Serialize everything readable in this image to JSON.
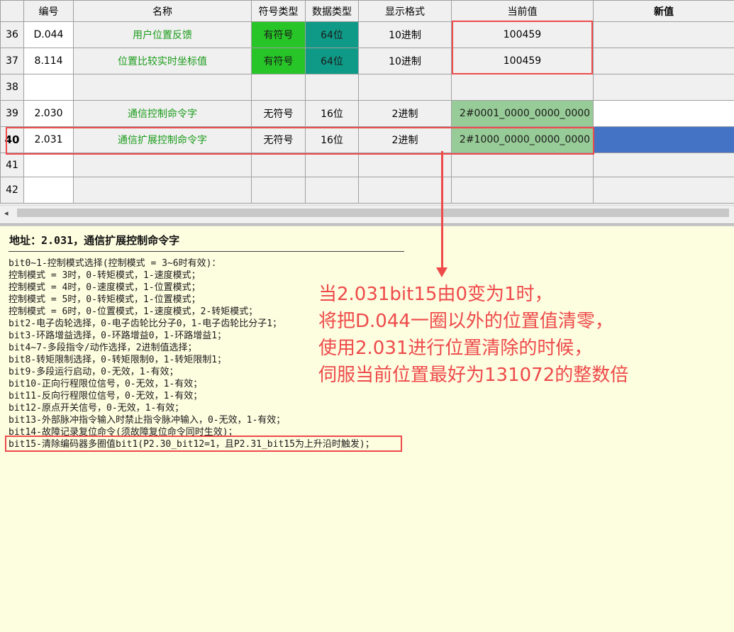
{
  "grid": {
    "headers": {
      "rownum": "",
      "code": "编号",
      "name": "名称",
      "sign_type": "符号类型",
      "data_type": "数据类型",
      "display_format": "显示格式",
      "current_value": "当前值",
      "new_value": "新值"
    },
    "rows": [
      {
        "num": "36",
        "code": "D.044",
        "name": "用户位置反馈",
        "sign_type": "有符号",
        "data_type": "64位",
        "format": "10进制",
        "current": "100459",
        "new": ""
      },
      {
        "num": "37",
        "code": "8.114",
        "name": "位置比较实时坐标值",
        "sign_type": "有符号",
        "data_type": "64位",
        "format": "10进制",
        "current": "100459",
        "new": ""
      },
      {
        "num": "38",
        "code": "",
        "name": "",
        "sign_type": "",
        "data_type": "",
        "format": "",
        "current": "",
        "new": ""
      },
      {
        "num": "39",
        "code": "2.030",
        "name": "通信控制命令字",
        "sign_type": "无符号",
        "data_type": "16位",
        "format": "2进制",
        "current": "2#0001_0000_0000_0000",
        "new": ""
      },
      {
        "num": "40",
        "code": "2.031",
        "name": "通信扩展控制命令字",
        "sign_type": "无符号",
        "data_type": "16位",
        "format": "2进制",
        "current": "2#1000_0000_0000_0000",
        "new": ""
      },
      {
        "num": "41",
        "code": "",
        "name": "",
        "sign_type": "",
        "data_type": "",
        "format": "",
        "current": "",
        "new": ""
      },
      {
        "num": "42",
        "code": "",
        "name": "",
        "sign_type": "",
        "data_type": "",
        "format": "",
        "current": "",
        "new": ""
      }
    ],
    "scroll_left_arrow": "◂"
  },
  "description": {
    "title": "地址：2.031，通信扩展控制命令字",
    "lines": [
      "bit0~1-控制模式选择(控制模式 = 3~6时有效)：",
      "控制模式 = 3时，0-转矩模式，1-速度模式；",
      "控制模式 = 4时，0-速度模式，1-位置模式；",
      "控制模式 = 5时，0-转矩模式，1-位置模式；",
      "控制模式 = 6时，0-位置模式，1-速度模式，2-转矩模式；",
      "bit2-电子齿轮选择，0-电子齿轮比分子0，1-电子齿轮比分子1；",
      "bit3-环路增益选择，0-环路增益0，1-环路增益1；",
      "bit4~7-多段指令/动作选择，2进制值选择；",
      "bit8-转矩限制选择，0-转矩限制0，1-转矩限制1；",
      "bit9-多段运行启动，0-无效，1-有效；",
      "bit10-正向行程限位信号，0-无效，1-有效；",
      "bit11-反向行程限位信号，0-无效，1-有效；",
      "bit12-原点开关信号，0-无效，1-有效；",
      "bit13-外部脉冲指令输入时禁止指令脉冲输入，0-无效，1-有效；",
      "bit14-故障记录复位命令(须故障复位命令同时生效)；",
      "bit15-清除编码器多圈值bit1(P2.30_bit12=1，且P2.31_bit15为上升沿时触发)；"
    ]
  },
  "annotation": {
    "lines": [
      "当2.031bit15由0变为1时，",
      "将把D.044一圈以外的位置值清零，",
      "使用2.031进行位置清除的时候，",
      "伺服当前位置最好为131072的整数倍"
    ],
    "color": "#ee4a4a"
  },
  "colors": {
    "name_text": "#1c9b1c",
    "signed_bg": "#27c527",
    "int64_bg": "#0f9a87",
    "binary_current_bg": "#97cb97",
    "selected_cell": "#4472c4",
    "description_bg": "#fdfde0"
  }
}
